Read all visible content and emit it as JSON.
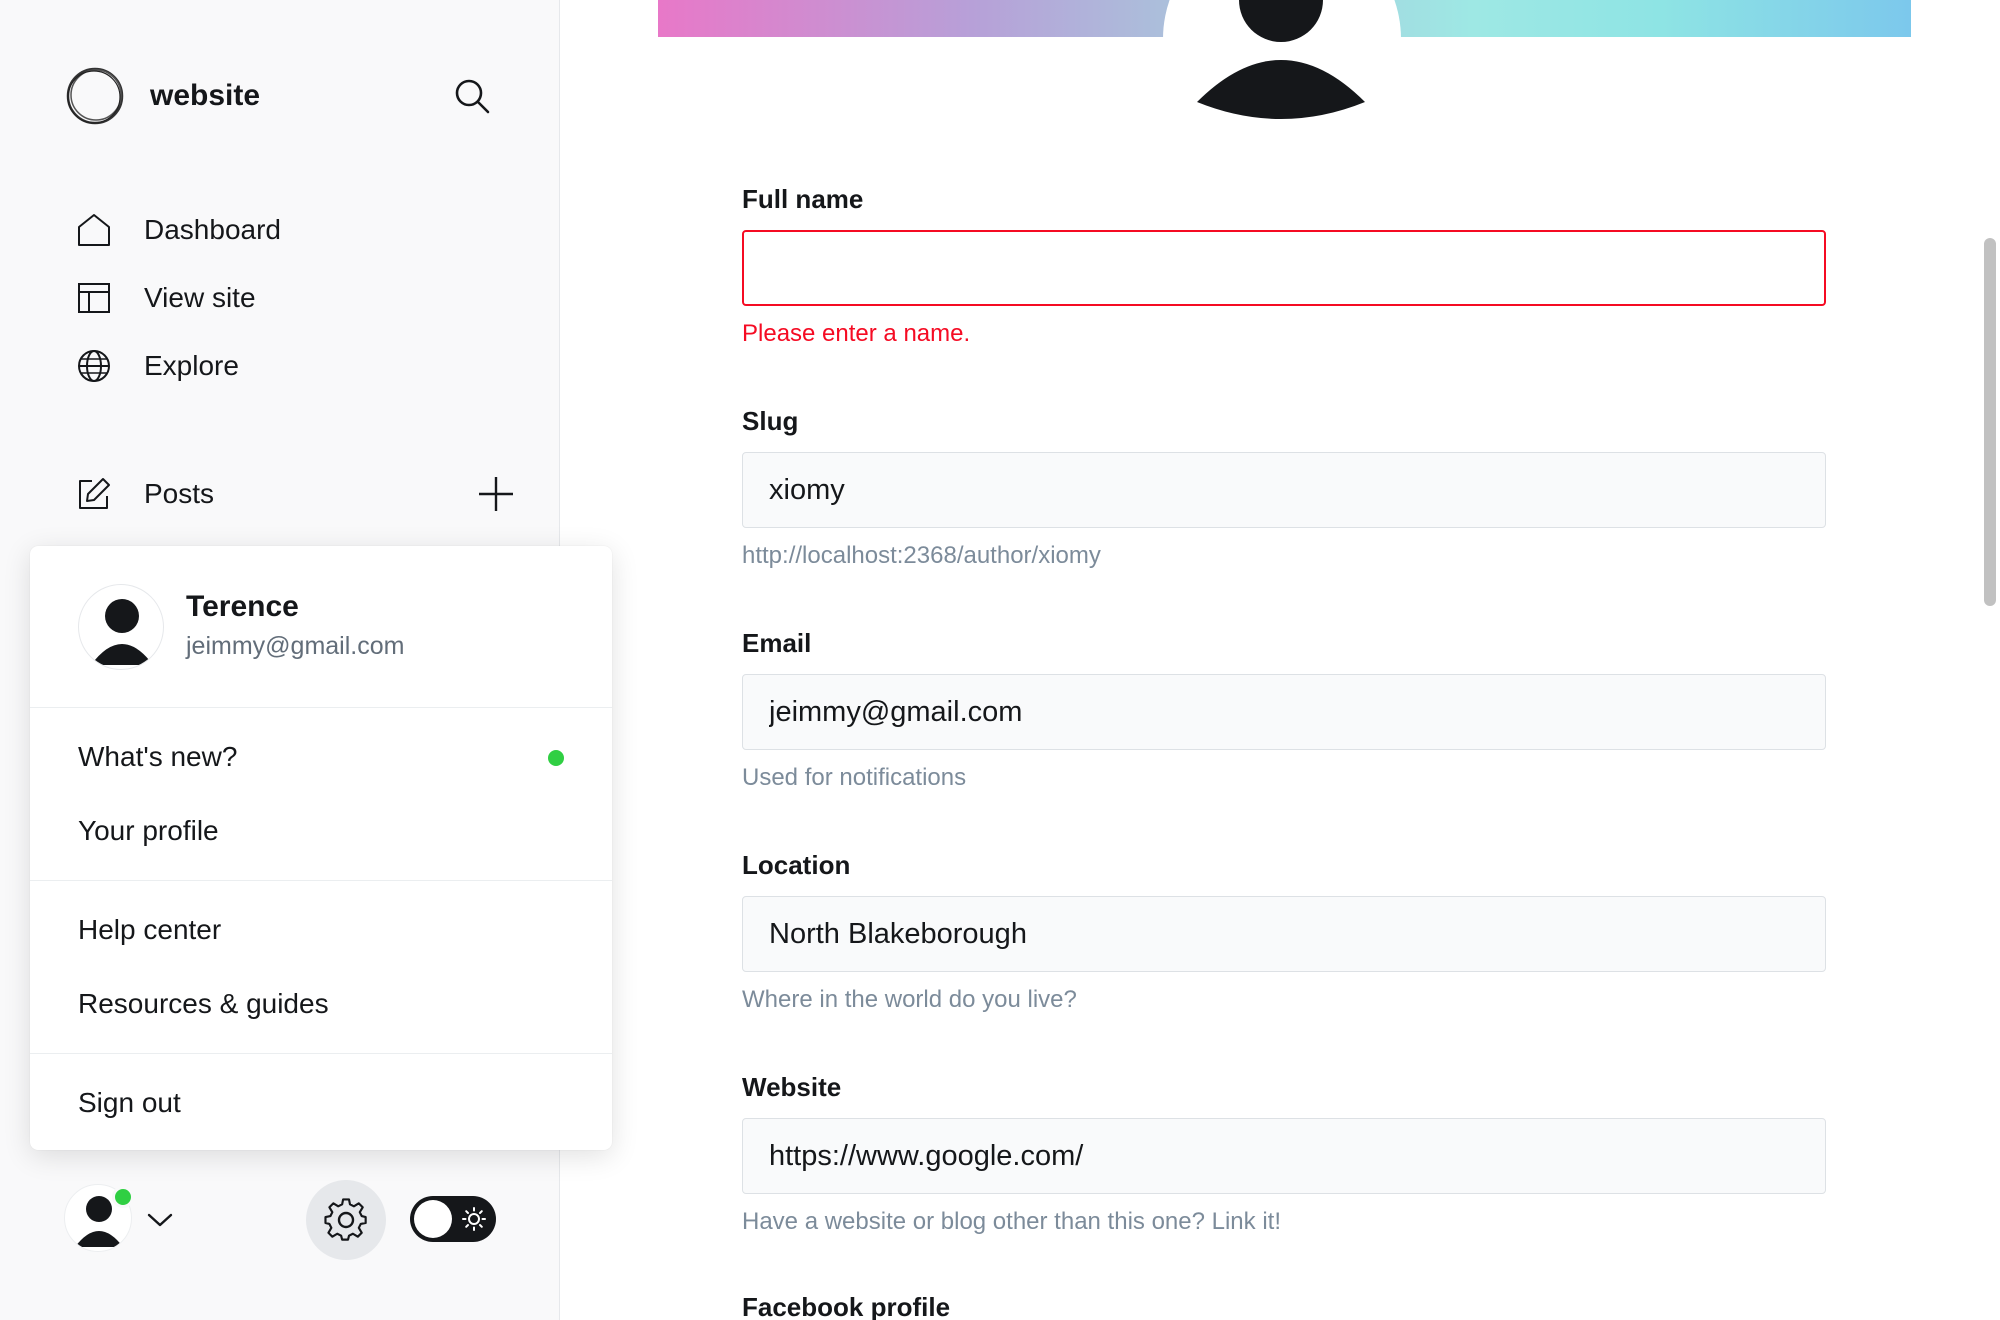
{
  "sidebar": {
    "brand": {
      "name": "website",
      "logo_icon": "ghost-logo-icon"
    },
    "search": {
      "icon": "search-icon"
    },
    "nav": [
      {
        "label": "Dashboard",
        "icon": "home-icon"
      },
      {
        "label": "View site",
        "icon": "layout-icon"
      },
      {
        "label": "Explore",
        "icon": "globe-icon"
      }
    ],
    "posts": {
      "label": "Posts",
      "icon": "edit-icon",
      "add_icon": "plus-icon"
    }
  },
  "account_menu": {
    "user": {
      "name": "Terence",
      "email": "jeimmy@gmail.com"
    },
    "groups": [
      [
        {
          "label": "What's new?",
          "has_dot": true
        },
        {
          "label": "Your profile"
        }
      ],
      [
        {
          "label": "Help center"
        },
        {
          "label": "Resources & guides"
        }
      ],
      [
        {
          "label": "Sign out"
        }
      ]
    ]
  },
  "footer": {
    "avatar_status": "online",
    "settings_icon": "gear-icon",
    "theme_toggle": "dark-mode-off"
  },
  "profile_form": {
    "full_name": {
      "label": "Full name",
      "value": "",
      "error": "Please enter a name."
    },
    "slug": {
      "label": "Slug",
      "value": "xiomy",
      "hint": "http://localhost:2368/author/xiomy"
    },
    "email": {
      "label": "Email",
      "value": "jeimmy@gmail.com",
      "hint": "Used for notifications"
    },
    "location": {
      "label": "Location",
      "value": "North Blakeborough",
      "hint": "Where in the world do you live?"
    },
    "website": {
      "label": "Website",
      "value": "https://www.google.com/",
      "hint": "Have a website or blog other than this one? Link it!"
    },
    "facebook": {
      "label": "Facebook profile"
    }
  },
  "colors": {
    "accent_error": "#f50b23",
    "status_online": "#30cf43",
    "text_primary": "#15171a",
    "text_muted": "#7c8b9a"
  }
}
